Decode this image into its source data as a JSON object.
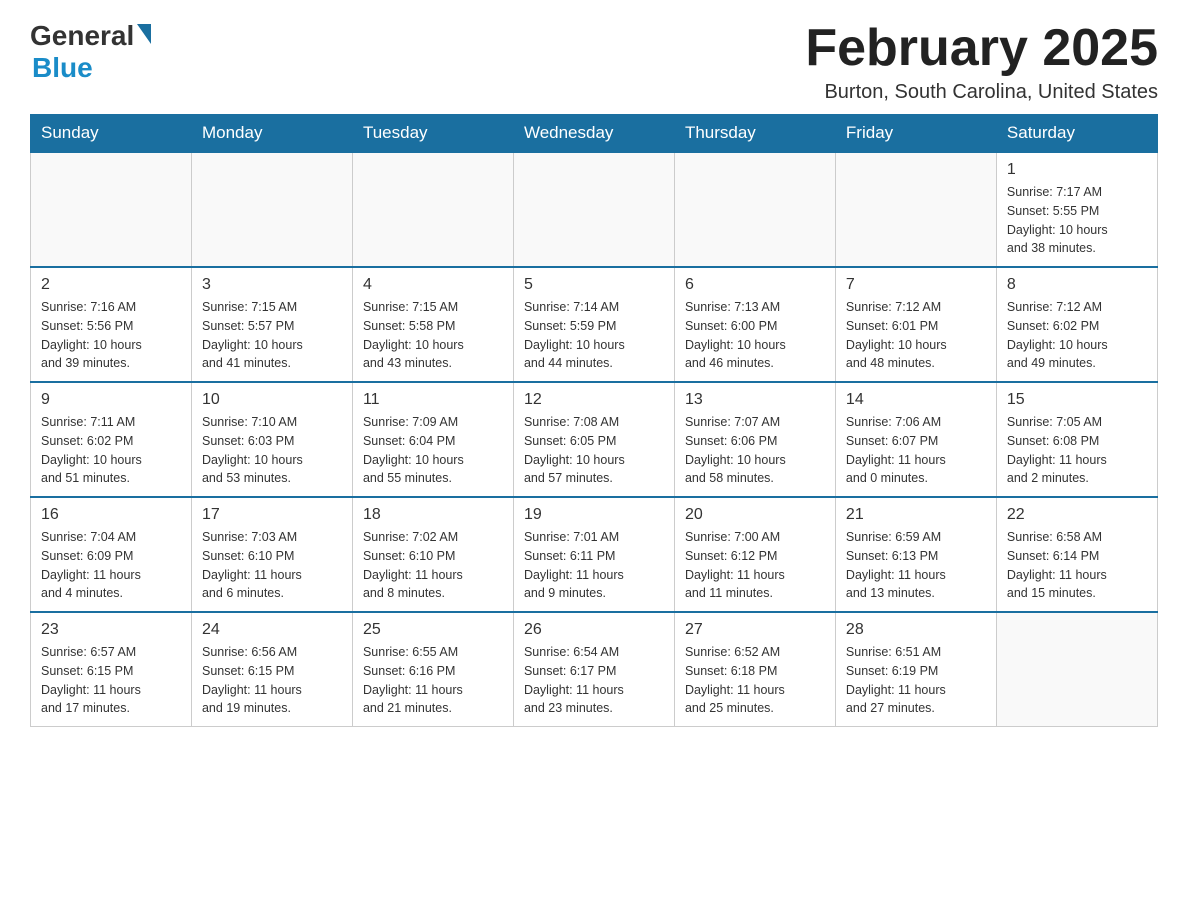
{
  "header": {
    "logo_general": "General",
    "logo_blue": "Blue",
    "title": "February 2025",
    "subtitle": "Burton, South Carolina, United States"
  },
  "days_of_week": [
    "Sunday",
    "Monday",
    "Tuesday",
    "Wednesday",
    "Thursday",
    "Friday",
    "Saturday"
  ],
  "weeks": [
    [
      {
        "day": "",
        "info": ""
      },
      {
        "day": "",
        "info": ""
      },
      {
        "day": "",
        "info": ""
      },
      {
        "day": "",
        "info": ""
      },
      {
        "day": "",
        "info": ""
      },
      {
        "day": "",
        "info": ""
      },
      {
        "day": "1",
        "info": "Sunrise: 7:17 AM\nSunset: 5:55 PM\nDaylight: 10 hours\nand 38 minutes."
      }
    ],
    [
      {
        "day": "2",
        "info": "Sunrise: 7:16 AM\nSunset: 5:56 PM\nDaylight: 10 hours\nand 39 minutes."
      },
      {
        "day": "3",
        "info": "Sunrise: 7:15 AM\nSunset: 5:57 PM\nDaylight: 10 hours\nand 41 minutes."
      },
      {
        "day": "4",
        "info": "Sunrise: 7:15 AM\nSunset: 5:58 PM\nDaylight: 10 hours\nand 43 minutes."
      },
      {
        "day": "5",
        "info": "Sunrise: 7:14 AM\nSunset: 5:59 PM\nDaylight: 10 hours\nand 44 minutes."
      },
      {
        "day": "6",
        "info": "Sunrise: 7:13 AM\nSunset: 6:00 PM\nDaylight: 10 hours\nand 46 minutes."
      },
      {
        "day": "7",
        "info": "Sunrise: 7:12 AM\nSunset: 6:01 PM\nDaylight: 10 hours\nand 48 minutes."
      },
      {
        "day": "8",
        "info": "Sunrise: 7:12 AM\nSunset: 6:02 PM\nDaylight: 10 hours\nand 49 minutes."
      }
    ],
    [
      {
        "day": "9",
        "info": "Sunrise: 7:11 AM\nSunset: 6:02 PM\nDaylight: 10 hours\nand 51 minutes."
      },
      {
        "day": "10",
        "info": "Sunrise: 7:10 AM\nSunset: 6:03 PM\nDaylight: 10 hours\nand 53 minutes."
      },
      {
        "day": "11",
        "info": "Sunrise: 7:09 AM\nSunset: 6:04 PM\nDaylight: 10 hours\nand 55 minutes."
      },
      {
        "day": "12",
        "info": "Sunrise: 7:08 AM\nSunset: 6:05 PM\nDaylight: 10 hours\nand 57 minutes."
      },
      {
        "day": "13",
        "info": "Sunrise: 7:07 AM\nSunset: 6:06 PM\nDaylight: 10 hours\nand 58 minutes."
      },
      {
        "day": "14",
        "info": "Sunrise: 7:06 AM\nSunset: 6:07 PM\nDaylight: 11 hours\nand 0 minutes."
      },
      {
        "day": "15",
        "info": "Sunrise: 7:05 AM\nSunset: 6:08 PM\nDaylight: 11 hours\nand 2 minutes."
      }
    ],
    [
      {
        "day": "16",
        "info": "Sunrise: 7:04 AM\nSunset: 6:09 PM\nDaylight: 11 hours\nand 4 minutes."
      },
      {
        "day": "17",
        "info": "Sunrise: 7:03 AM\nSunset: 6:10 PM\nDaylight: 11 hours\nand 6 minutes."
      },
      {
        "day": "18",
        "info": "Sunrise: 7:02 AM\nSunset: 6:10 PM\nDaylight: 11 hours\nand 8 minutes."
      },
      {
        "day": "19",
        "info": "Sunrise: 7:01 AM\nSunset: 6:11 PM\nDaylight: 11 hours\nand 9 minutes."
      },
      {
        "day": "20",
        "info": "Sunrise: 7:00 AM\nSunset: 6:12 PM\nDaylight: 11 hours\nand 11 minutes."
      },
      {
        "day": "21",
        "info": "Sunrise: 6:59 AM\nSunset: 6:13 PM\nDaylight: 11 hours\nand 13 minutes."
      },
      {
        "day": "22",
        "info": "Sunrise: 6:58 AM\nSunset: 6:14 PM\nDaylight: 11 hours\nand 15 minutes."
      }
    ],
    [
      {
        "day": "23",
        "info": "Sunrise: 6:57 AM\nSunset: 6:15 PM\nDaylight: 11 hours\nand 17 minutes."
      },
      {
        "day": "24",
        "info": "Sunrise: 6:56 AM\nSunset: 6:15 PM\nDaylight: 11 hours\nand 19 minutes."
      },
      {
        "day": "25",
        "info": "Sunrise: 6:55 AM\nSunset: 6:16 PM\nDaylight: 11 hours\nand 21 minutes."
      },
      {
        "day": "26",
        "info": "Sunrise: 6:54 AM\nSunset: 6:17 PM\nDaylight: 11 hours\nand 23 minutes."
      },
      {
        "day": "27",
        "info": "Sunrise: 6:52 AM\nSunset: 6:18 PM\nDaylight: 11 hours\nand 25 minutes."
      },
      {
        "day": "28",
        "info": "Sunrise: 6:51 AM\nSunset: 6:19 PM\nDaylight: 11 hours\nand 27 minutes."
      },
      {
        "day": "",
        "info": ""
      }
    ]
  ]
}
